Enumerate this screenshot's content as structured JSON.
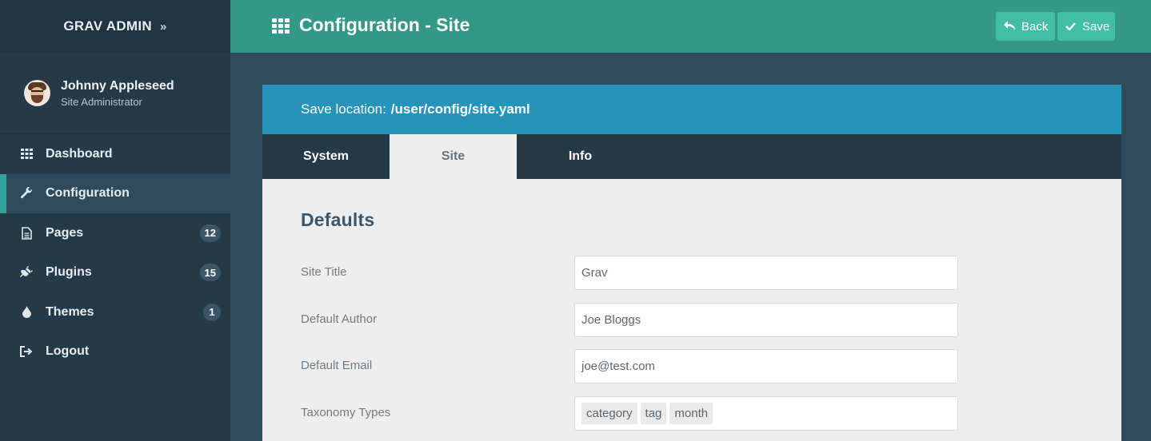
{
  "brand": {
    "title": "GRAV ADMIN",
    "chevron": "»"
  },
  "user": {
    "name": "Johnny Appleseed",
    "role": "Site Administrator"
  },
  "nav": [
    {
      "label": "Dashboard",
      "icon": "grid-icon",
      "badge": null,
      "active": false
    },
    {
      "label": "Configuration",
      "icon": "wrench-icon",
      "badge": null,
      "active": true
    },
    {
      "label": "Pages",
      "icon": "file-icon",
      "badge": "12",
      "active": false
    },
    {
      "label": "Plugins",
      "icon": "plug-icon",
      "badge": "15",
      "active": false
    },
    {
      "label": "Themes",
      "icon": "tint-icon",
      "badge": "1",
      "active": false
    },
    {
      "label": "Logout",
      "icon": "sign-out-icon",
      "badge": null,
      "active": false
    }
  ],
  "header": {
    "title": "Configuration - Site",
    "back_label": "Back",
    "save_label": "Save"
  },
  "location": {
    "prefix": "Save location:",
    "path": "/user/config/site.yaml"
  },
  "tabs": [
    {
      "label": "System",
      "active": false
    },
    {
      "label": "Site",
      "active": true
    },
    {
      "label": "Info",
      "active": false
    }
  ],
  "form": {
    "section_title": "Defaults",
    "fields": [
      {
        "label": "Site Title",
        "value": "Grav"
      },
      {
        "label": "Default Author",
        "value": "Joe Bloggs"
      },
      {
        "label": "Default Email",
        "value": "joe@test.com"
      }
    ],
    "taxonomy": {
      "label": "Taxonomy Types",
      "tags": [
        "category",
        "tag",
        "month"
      ]
    }
  },
  "colors": {
    "sidebar": "#253a47",
    "header": "#349886",
    "accent_button": "#41bea3",
    "location_bar": "#2593ba",
    "active_indicator": "#2fa49b"
  }
}
